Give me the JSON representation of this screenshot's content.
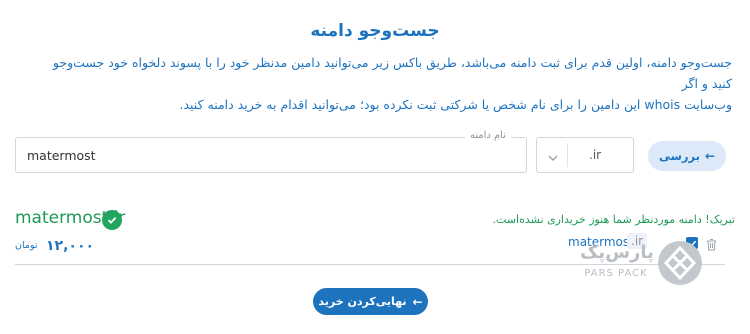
{
  "page": {
    "title": "جست‌وجو دامنه",
    "intro_line1": "جست‌وجو دامنه، اولین قدم برای ثبت دامنه می‌باشد، طریق باکس زیر می‌توانید دامین مدنظر خود را با پسوند دلخواه خود جست‌وجو کنید و اگر",
    "intro_line2": "وب‌سایت whois این دامین را برای نام شخص یا شرکتی ثبت نکرده بود؛ می‌توانید اقدام به خرید دامنه کنید."
  },
  "search": {
    "field_label": "نام دامنه",
    "domain_value": "matermost",
    "tld_value": ".ir",
    "button_label": "بررسی",
    "button_icon": "arrow-left-icon"
  },
  "result": {
    "domain": "matermost.ir",
    "status_icon": "check-circle-icon",
    "message": "تبریک! دامنه موردنظر شما هنوز خریداری نشده‌است.",
    "price": "۱۲,۰۰۰",
    "price_unit": "تومان"
  },
  "cart_item": {
    "domain": "matermost",
    "tld": ".ir",
    "checkbox_checked": true,
    "remove_icon": "trash-icon"
  },
  "footer": {
    "finalize_label": "نهایی‌کردن خرید",
    "finalize_icon": "arrow-left-icon"
  },
  "logo": {
    "text_fa": "پارس‌پک",
    "text_en": "PARS PACK"
  },
  "colors": {
    "primary": "#1e73be",
    "success": "#1e9a55",
    "search_button_bg": "#dbe9f8",
    "border": "#cfd6dd"
  }
}
